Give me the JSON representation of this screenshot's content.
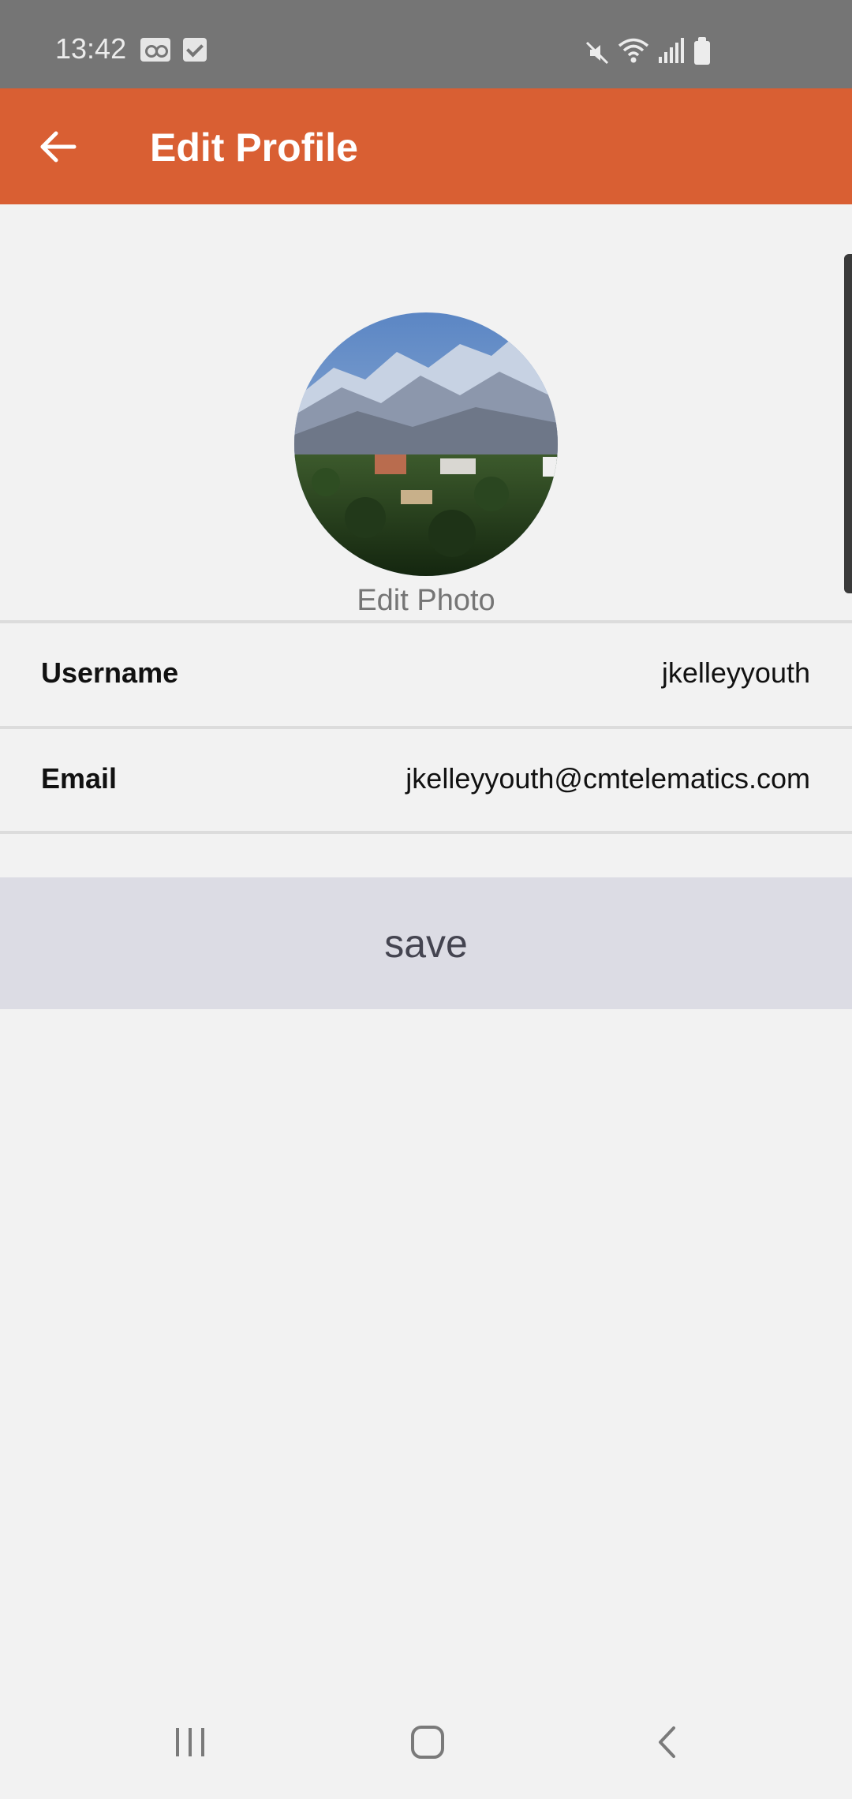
{
  "status_bar": {
    "time": "13:42",
    "icons": [
      "voicemail-icon",
      "checkbox-icon",
      "mute-icon",
      "wifi-icon",
      "signal-icon",
      "battery-icon"
    ]
  },
  "app_bar": {
    "title": "Edit Profile",
    "back_icon": "arrow-left-icon",
    "color": "#d95f33"
  },
  "profile": {
    "edit_photo_label": "Edit Photo",
    "fields": [
      {
        "label": "Username",
        "value": "jkelleyyouth"
      },
      {
        "label": "Email",
        "value": "jkelleyyouth@cmtelematics.com"
      }
    ],
    "save_label": "save"
  },
  "nav_bar": {
    "icons": [
      "recent-apps-icon",
      "home-icon",
      "back-icon"
    ]
  }
}
